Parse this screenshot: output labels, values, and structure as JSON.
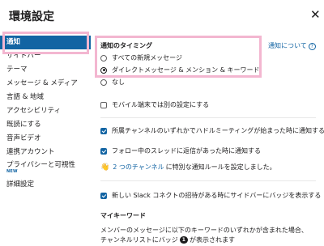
{
  "dialog": {
    "title": "環境設定",
    "close_glyph": "✕"
  },
  "sidebar": {
    "items": [
      {
        "label": "通知"
      },
      {
        "label": "サイドバー"
      },
      {
        "label": "テーマ"
      },
      {
        "label": "メッセージ & メディア"
      },
      {
        "label": "言語 & 地域"
      },
      {
        "label": "アクセシビリティ"
      },
      {
        "label": "既読にする"
      },
      {
        "label": "音声ビデオ"
      },
      {
        "label": "連携アカウント"
      },
      {
        "label": "プライバシーと可視性",
        "badge": "NEW"
      },
      {
        "label": "詳細設定"
      }
    ]
  },
  "notifications": {
    "timing_title": "通知のタイミング",
    "about_link": "通知について",
    "about_help_glyph": "?",
    "timing_options": [
      {
        "label": "すべての新規メッセージ",
        "checked": false
      },
      {
        "label": "ダイレクトメッセージ & メンション & キーワード",
        "checked": true
      },
      {
        "label": "なし",
        "checked": false
      }
    ],
    "mobile_separate": {
      "label": "モバイル端末では別の設定にする",
      "checked": false
    },
    "huddle": {
      "label": "所属チャンネルのいずれかでハドルミーティングが始まった時に通知する",
      "checked": true
    },
    "thread_reply": {
      "label": "フォロー中のスレッドに返信があった時に通知する",
      "checked": true
    },
    "channel_rule": {
      "icon": "hand-pointing-icon",
      "link_text": "2 つのチャンネル",
      "suffix": "に特別な通知ルールを設定しました。"
    },
    "slack_connect": {
      "label": "新しい Slack コネクトの招待がある時にサイドバーにバッジを表示する",
      "checked": true
    },
    "keywords": {
      "title": "マイキーワード",
      "desc_line1": "メンバーのメッセージに以下のキーワードのいずれかが含まれた場合、",
      "desc_line2_pre": "チャンネルリストにバッジ",
      "badge": "1",
      "desc_line2_post": "が表示されます"
    }
  }
}
